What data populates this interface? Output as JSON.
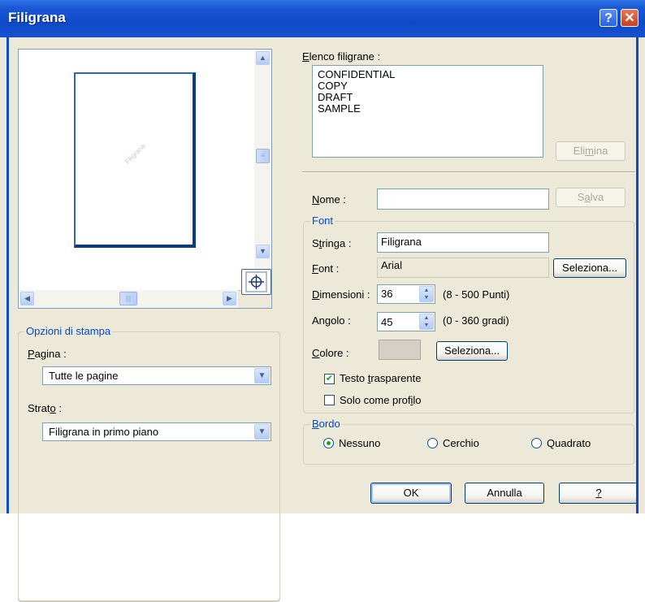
{
  "window": {
    "title": "Filigrana",
    "help_label": "?",
    "close_label": "✕"
  },
  "preview": {
    "watermark_text": "Filigrana"
  },
  "print_options": {
    "group_label": "Opzioni di stampa",
    "page_label_pre": "",
    "page_label_ul": "P",
    "page_label_post": "agina :",
    "page_value": "Tutte le pagine",
    "layer_label_pre": "Strat",
    "layer_label_ul": "o",
    "layer_label_post": " :",
    "layer_value": "Filigrana in primo piano"
  },
  "watermark_list": {
    "label_ul": "E",
    "label_post": "lenco filigrane :",
    "items": [
      "CONFIDENTIAL",
      "COPY",
      "DRAFT",
      "SAMPLE"
    ],
    "delete_pre": "Eli",
    "delete_ul": "m",
    "delete_post": "ina"
  },
  "name": {
    "label_ul": "N",
    "label_post": "ome :",
    "value": "",
    "save_pre": "S",
    "save_ul": "a",
    "save_post": "lva"
  },
  "font_group": {
    "group_label": "Font",
    "string_pre": "S",
    "string_ul": "t",
    "string_post": "ringa :",
    "string_value": "Filigrana",
    "font_ul": "F",
    "font_post": "ont :",
    "font_value": "Arial",
    "select_label": "Seleziona...",
    "size_ul": "D",
    "size_post": "imensioni :",
    "size_value": "36",
    "size_range": "(8 - 500 Punti)",
    "angle_label": "Angolo :",
    "angle_value": "45",
    "angle_range": "(0 - 360 gradi)",
    "color_ul": "C",
    "color_post": "olore :",
    "color_value": "#d4d0c8",
    "color_select_label": "Seleziona...",
    "transparent_pre": "Testo ",
    "transparent_ul": "t",
    "transparent_post": "rasparente",
    "transparent_checked": true,
    "outline_pre": "Solo come prof",
    "outline_ul": "i",
    "outline_post": "lo",
    "outline_checked": false
  },
  "border_group": {
    "group_label_ul": "B",
    "group_label_post": "ordo",
    "options": [
      "Nessuno",
      "Cerchio",
      "Quadrato"
    ],
    "selected": "Nessuno"
  },
  "buttons": {
    "ok": "OK",
    "cancel": "Annulla",
    "help": "?"
  }
}
